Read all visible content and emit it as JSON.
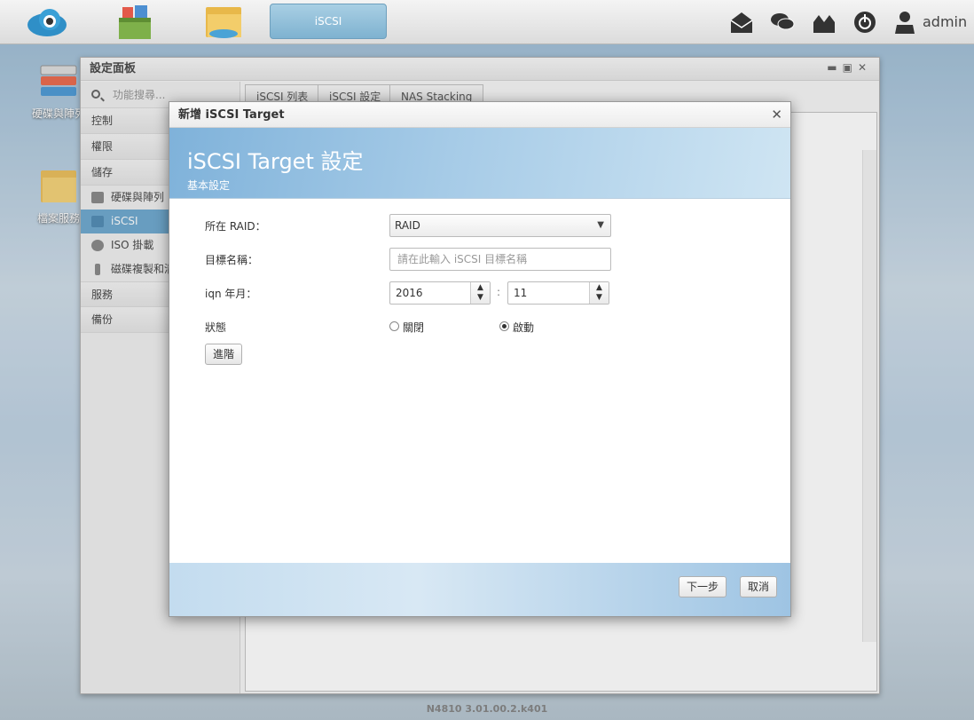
{
  "taskbar": {
    "active_task_label": "iSCSI",
    "user_label": "admin",
    "icons": [
      "cloud-app-icon",
      "apps-icon",
      "folder-icon",
      "mail-icon",
      "chat-icon",
      "network-icon",
      "power-icon",
      "user-icon"
    ]
  },
  "desktop": {
    "icons": [
      {
        "label": "硬碟與陣列",
        "icon": "disk-array-icon"
      },
      {
        "label": "檔案服務",
        "icon": "file-service-icon"
      }
    ]
  },
  "settings_panel": {
    "title": "設定面板",
    "search_placeholder": "功能搜尋...",
    "nav": {
      "control": "控制",
      "permission": "權限",
      "storage": "儲存",
      "storage_items": [
        "硬碟與陣列",
        "iSCSI",
        "ISO 掛載",
        "磁碟複製和清"
      ],
      "services": "服務",
      "backup": "備份"
    },
    "tabs": [
      "iSCSI 列表",
      "iSCSI 設定",
      "NAS Stacking"
    ]
  },
  "modal": {
    "title": "新增 iSCSI Target",
    "banner_title": "iSCSI Target 設定",
    "banner_subtitle": "基本設定",
    "raid_label": "所在 RAID：",
    "raid_value": "RAID",
    "target_name_label": "目標名稱：",
    "target_name_placeholder": "請在此輸入 iSCSI 目標名稱",
    "iqn_label": "iqn 年月：",
    "iqn_year": "2016",
    "iqn_separator": ":",
    "iqn_month": "11",
    "status_label": "狀態",
    "status_off": "關閉",
    "status_on": "啟動",
    "status_selected": "on",
    "advanced_button": "進階",
    "next_button": "下一步",
    "cancel_button": "取消"
  },
  "footer": {
    "version": "N4810   3.01.00.2.k401"
  }
}
